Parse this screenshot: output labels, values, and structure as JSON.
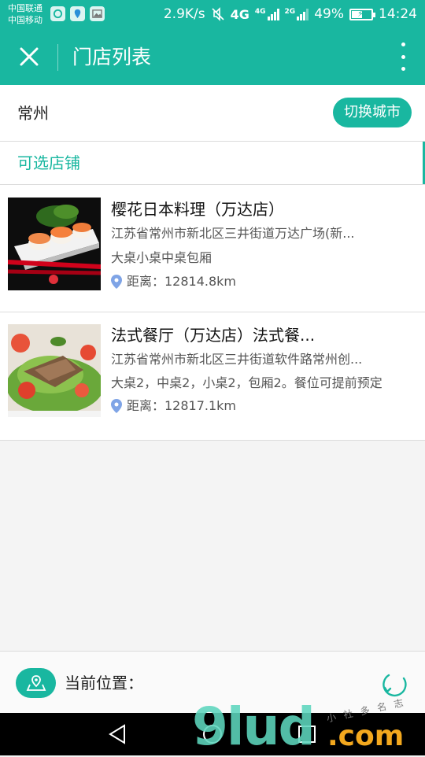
{
  "status_bar": {
    "carrier_1": "中国联通",
    "carrier_2": "中国移动",
    "speed": "2.9K/s",
    "network_1": "4G",
    "network_2": "4G",
    "network_3": "2G",
    "battery": "49%",
    "battery_level": 0.49,
    "time": "14:24"
  },
  "header": {
    "title": "门店列表",
    "close_icon": "close-icon",
    "more_icon": "more-vertical-icon"
  },
  "city": {
    "name": "常州",
    "switch_label": "切换城市"
  },
  "section": {
    "title": "可选店铺"
  },
  "stores": [
    {
      "name": "樱花日本料理（万达店）",
      "address": "江苏省常州市新北区三井街道万达广场(新...",
      "tables": "大桌小桌中桌包厢",
      "distance": "距离：12814.8km",
      "thumb_icon": "sushi-photo"
    },
    {
      "name": "法式餐厅（万达店）法式餐...",
      "address": "江苏省常州市新北区三井街道软件路常州创...",
      "tables": "大桌2，中桌2，小桌2，包厢2。餐位可提前预定",
      "distance": "距离：12817.1km",
      "thumb_icon": "salad-photo"
    }
  ],
  "location": {
    "label": "当前位置：",
    "map_icon": "map-pin-icon",
    "refresh_icon": "refresh-icon"
  },
  "watermark": {
    "digits": "9lud",
    "domain": ".com",
    "small": "小 社 多 名 志"
  },
  "colors": {
    "accent": "#19b7a0",
    "text_primary": "#222222",
    "text_secondary": "#555555",
    "pin": "#7fa4e6"
  }
}
